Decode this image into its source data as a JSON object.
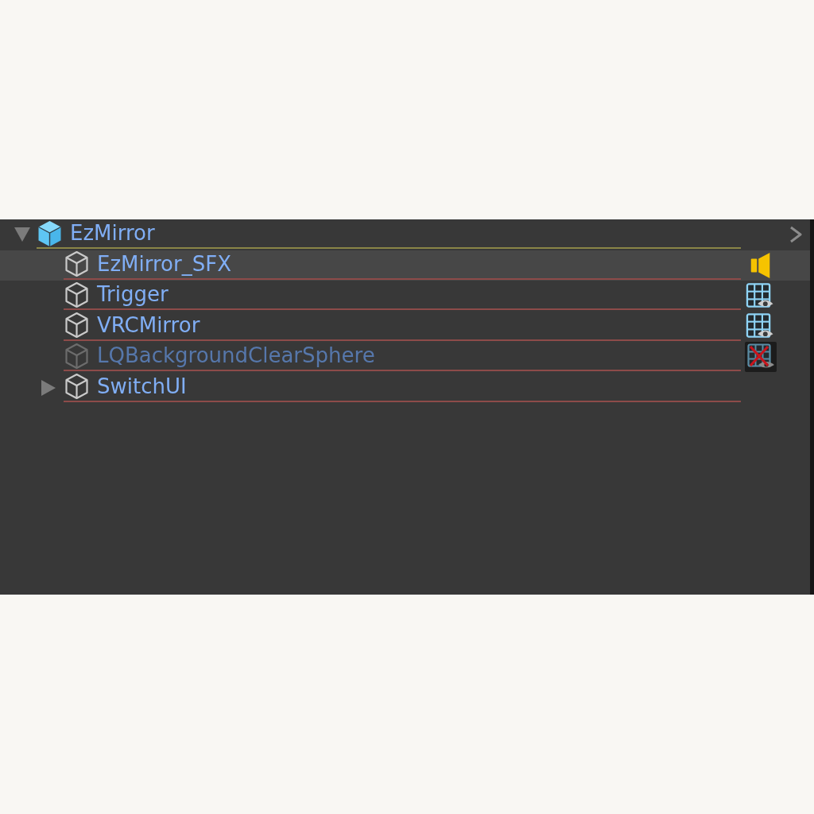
{
  "hierarchy": {
    "root": {
      "name": "EzMirror",
      "kind": "prefab",
      "active": true,
      "highlighted": false,
      "expanded": true,
      "children": [
        {
          "name": "EzMirror_SFX",
          "kind": "object",
          "active": true,
          "highlighted": true,
          "component": {
            "kind": "audio",
            "enabled": true
          }
        },
        {
          "name": "Trigger",
          "kind": "object",
          "active": true,
          "highlighted": false,
          "component": {
            "kind": "renderer",
            "enabled": true
          }
        },
        {
          "name": "VRCMirror",
          "kind": "object",
          "active": true,
          "highlighted": false,
          "component": {
            "kind": "renderer",
            "enabled": true
          }
        },
        {
          "name": "LQBackgroundClearSphere",
          "kind": "object",
          "active": false,
          "highlighted": false,
          "component": {
            "kind": "renderer",
            "enabled": false
          }
        },
        {
          "name": "SwitchUI",
          "kind": "object",
          "active": true,
          "highlighted": false,
          "expanded": false
        }
      ]
    }
  }
}
